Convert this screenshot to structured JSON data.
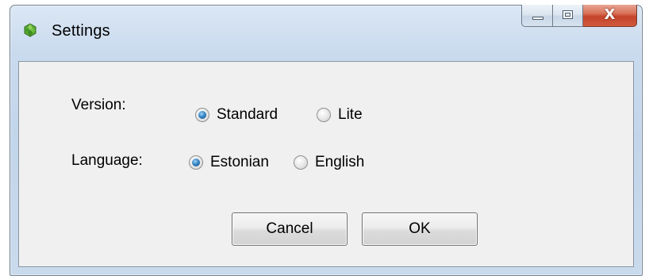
{
  "window": {
    "title": "Settings",
    "app_icon": "green-gem-icon",
    "controls": {
      "minimize_icon": "minimize-icon",
      "maximize_icon": "maximize-icon",
      "close_glyph": "X"
    }
  },
  "form": {
    "version": {
      "label": "Version:",
      "options": [
        {
          "label": "Standard",
          "checked": true
        },
        {
          "label": "Lite",
          "checked": false
        }
      ]
    },
    "language": {
      "label": "Language:",
      "options": [
        {
          "label": "Estonian",
          "checked": true
        },
        {
          "label": "English",
          "checked": false
        }
      ]
    }
  },
  "buttons": {
    "cancel": "Cancel",
    "ok": "OK"
  },
  "colors": {
    "radio_selected": "#2f7fc0",
    "close_button": "#c4442a",
    "icon_green": "#5aa832"
  }
}
